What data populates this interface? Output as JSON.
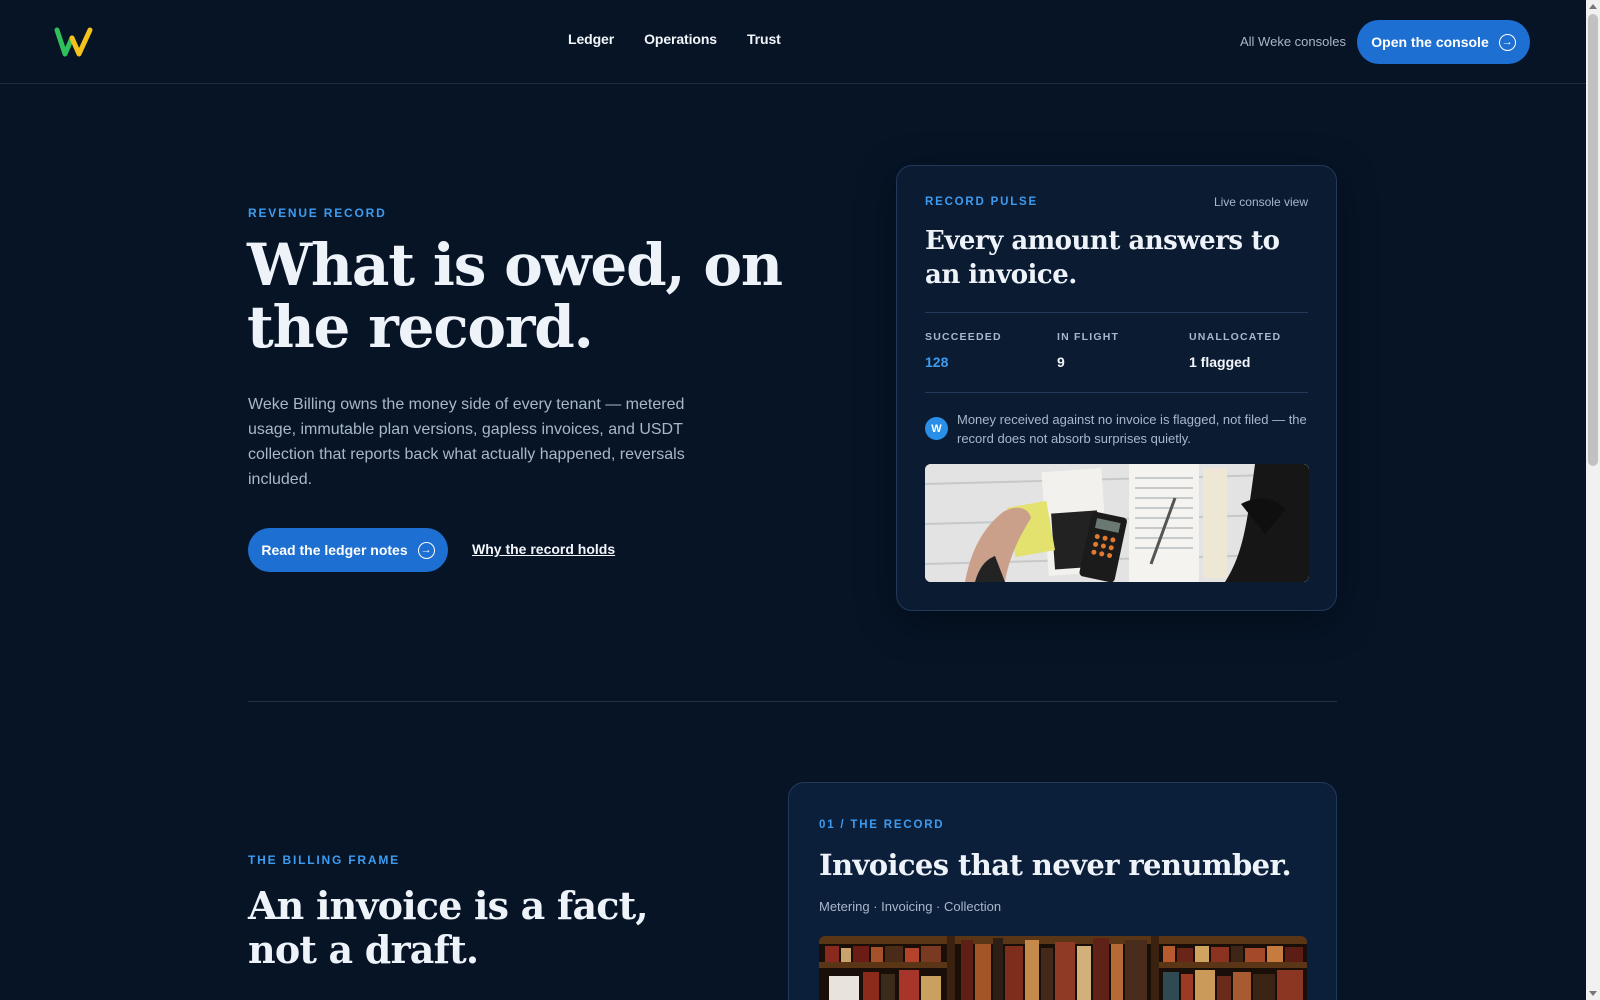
{
  "brand": {
    "logo_letter": "W",
    "logo_colors": [
      "#2fbf5b",
      "#f5c21b"
    ]
  },
  "nav": {
    "items": [
      {
        "label": "Ledger"
      },
      {
        "label": "Operations"
      },
      {
        "label": "Trust"
      }
    ]
  },
  "header": {
    "all_consoles_label": "All Weke consoles",
    "console_button_label": "Open the console",
    "arrow_icon": "arrow-right-circle-icon"
  },
  "hero": {
    "eyebrow": "REVENUE RECORD",
    "title": "What is owed, on the record.",
    "body": "Weke Billing owns the money side of every tenant — metered usage, immutable plan versions, gapless invoices, and USDT collection that reports back what actually happened, reversals included.",
    "primary_cta": "Read the ledger notes",
    "secondary_cta": "Why the record holds"
  },
  "pulse": {
    "eyebrow": "RECORD PULSE",
    "live_label": "Live console view",
    "title": "Every amount answers to an invoice.",
    "stats": [
      {
        "label": "SUCCEEDED",
        "value": "128"
      },
      {
        "label": "IN FLIGHT",
        "value": "9"
      },
      {
        "label": "UNALLOCATED",
        "value": "1 flagged"
      }
    ],
    "note_badge": "W",
    "note": "Money received against no invoice is flagged, not filed — the record does not absorb surprises quietly."
  },
  "frame": {
    "eyebrow": "THE BILLING FRAME",
    "title": "An invoice is a fact, not a draft."
  },
  "record_card": {
    "eyebrow": "01 / THE RECORD",
    "title": "Invoices that never renumber.",
    "tags": "Metering · Invoicing · Collection"
  },
  "colors": {
    "background": "#061426",
    "accent": "#1e6fd2",
    "accent_text": "#3d9bf0",
    "card": "#0b1b31"
  }
}
